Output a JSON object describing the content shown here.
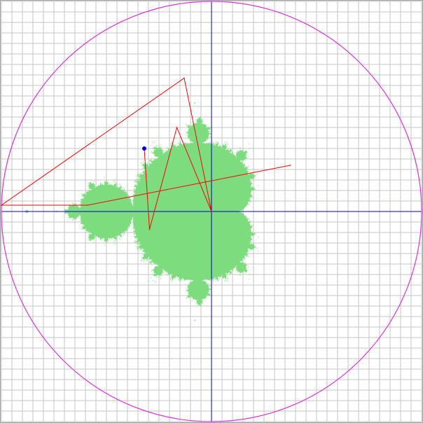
{
  "view": {
    "x_range": [
      -2.0,
      2.0
    ],
    "y_range": [
      -2.0,
      2.0
    ],
    "grid_step": 0.1
  },
  "colors": {
    "background": "#ffffff",
    "grid": "#c4c4c4",
    "frame": "#9a9a9a",
    "axes": "#0000cc",
    "circle": "#dd33dd",
    "set_fill": "#7ddc7d",
    "orbit": "#ff0000",
    "start_point": "#0000ee"
  },
  "set": {
    "name_icon": "mandelbrot-set",
    "max_iter": 60
  },
  "circle": {
    "radius": 2.0
  },
  "orbit": {
    "points": [
      [
        -0.64,
        0.6
      ],
      [
        -0.59,
        -0.17
      ],
      [
        -0.33,
        0.8
      ],
      [
        0.0,
        0.0
      ],
      [
        -0.26,
        1.27
      ],
      [
        -2.0,
        0.06
      ],
      [
        -1.18,
        0.06
      ],
      [
        0.75,
        0.44
      ]
    ]
  },
  "start_point": {
    "x": -0.64,
    "y": 0.6
  }
}
